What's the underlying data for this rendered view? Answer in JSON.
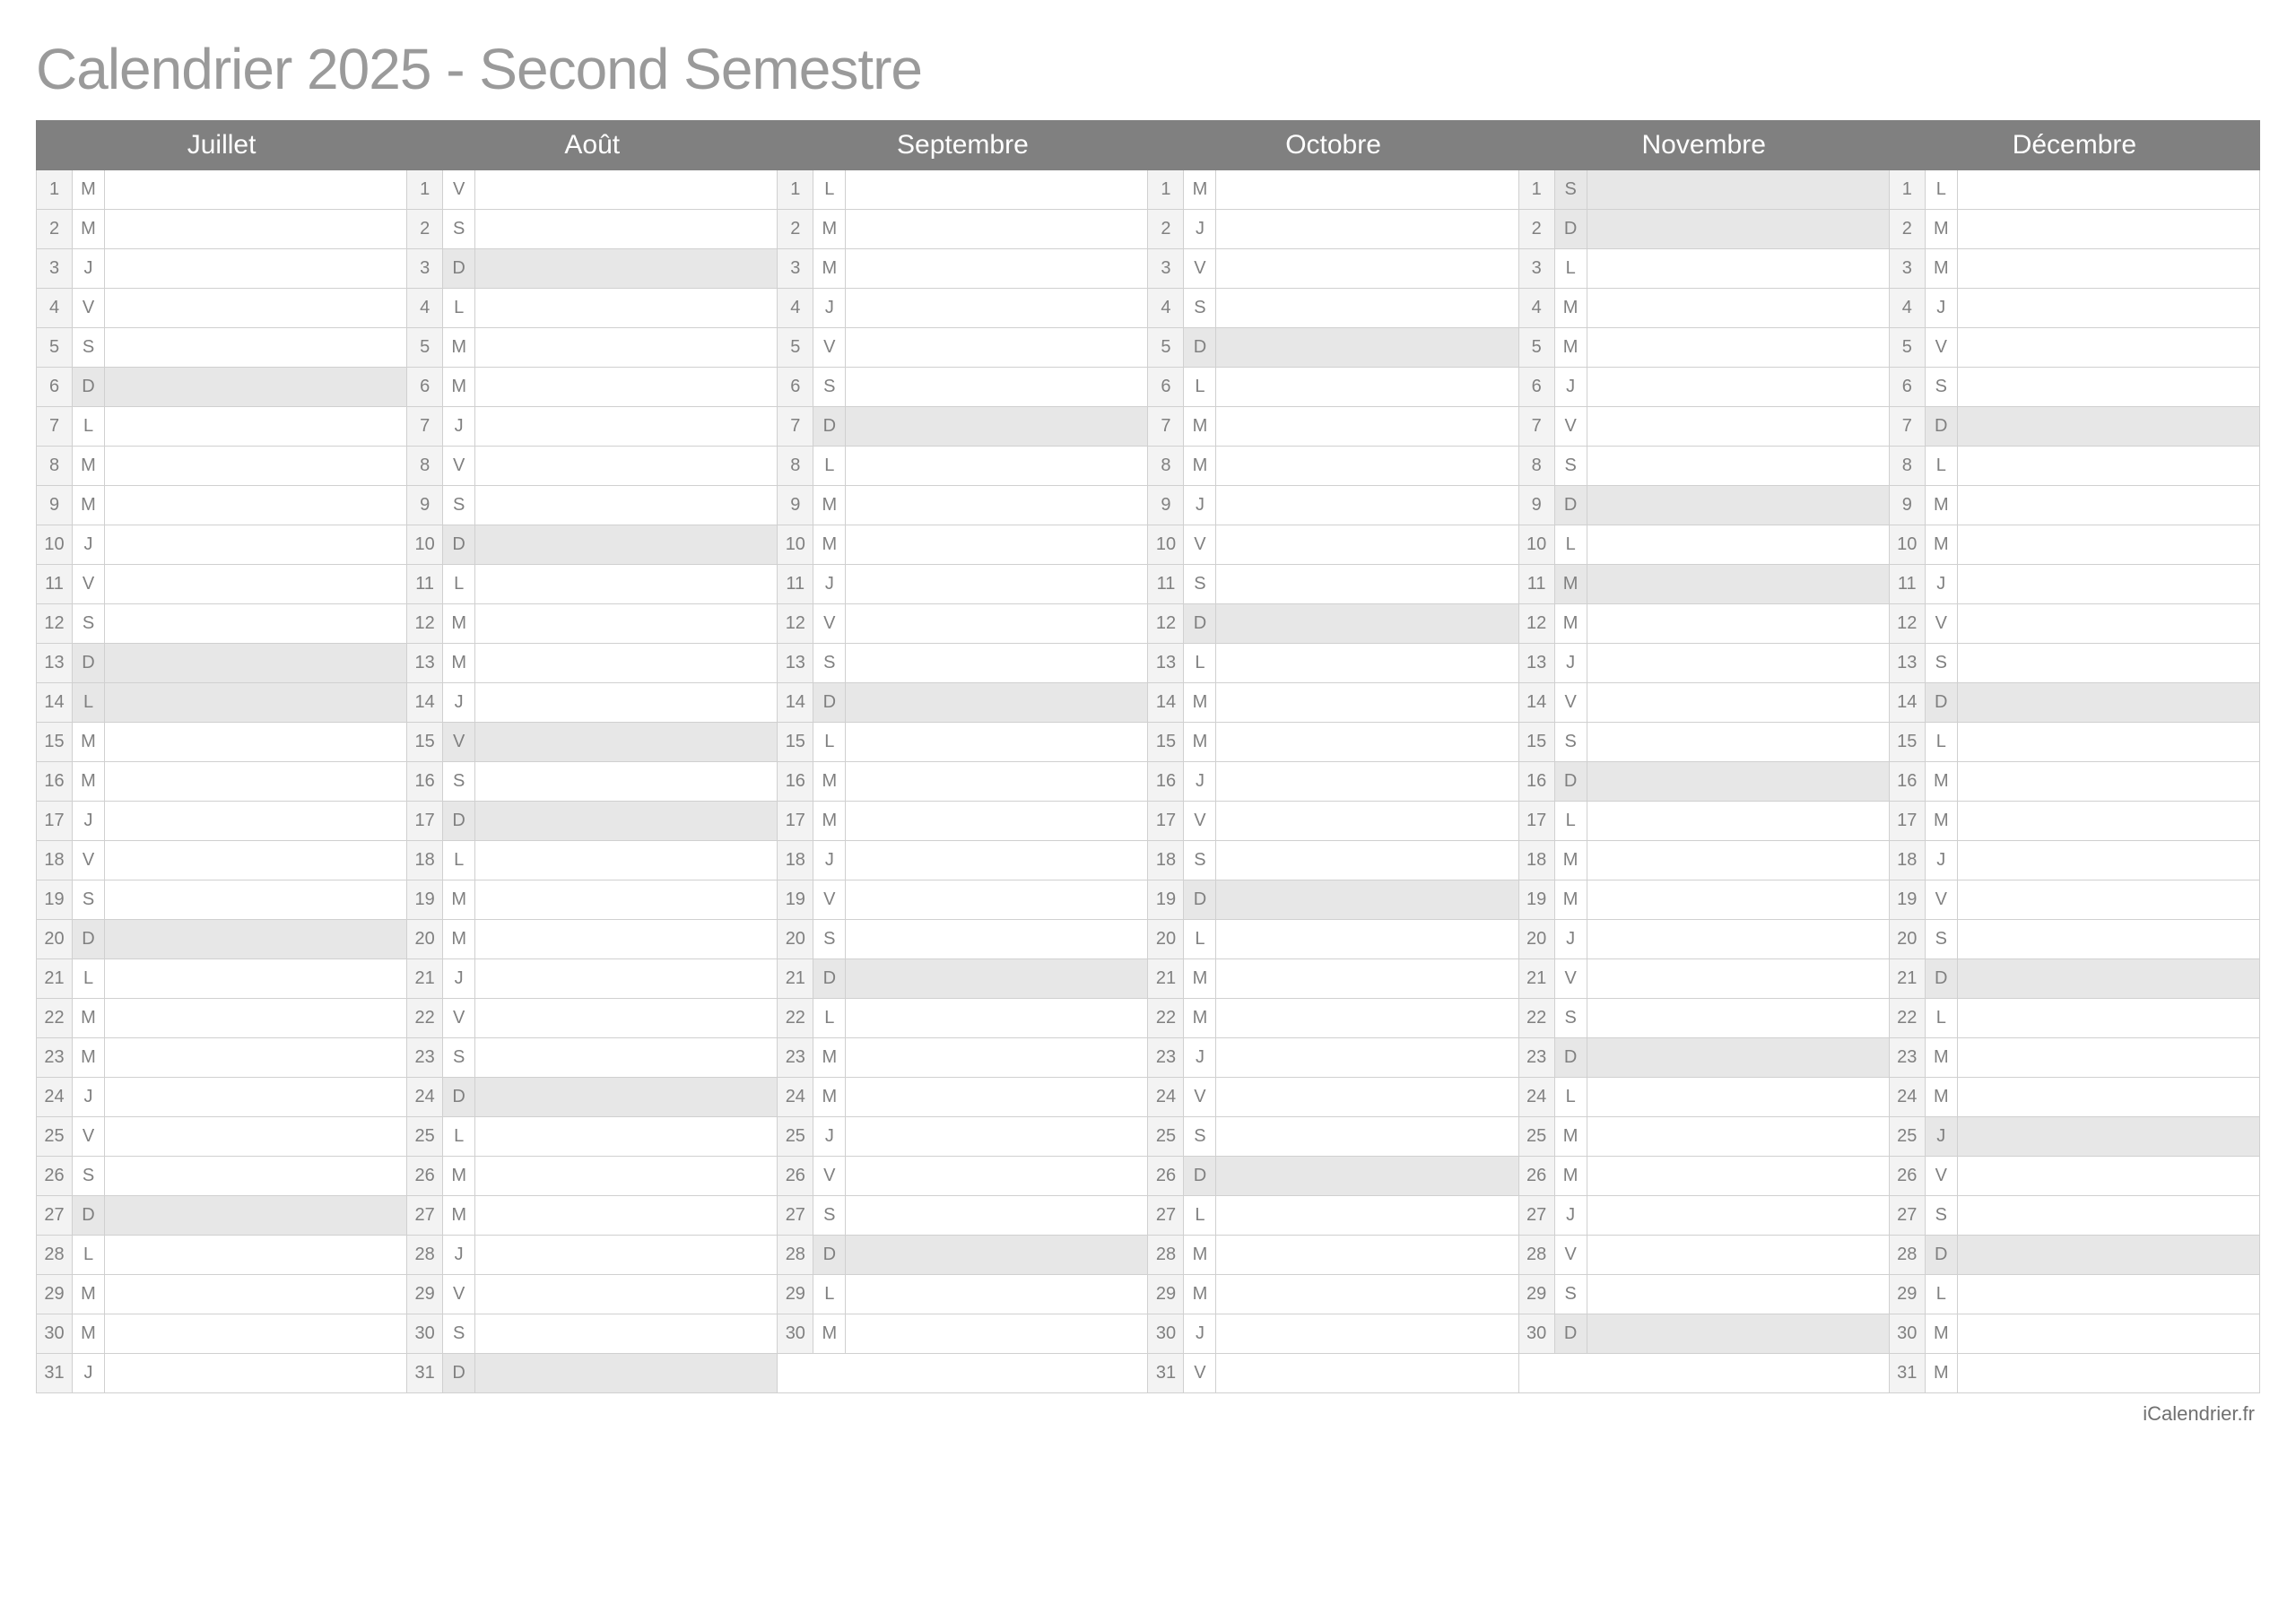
{
  "title": "Calendrier 2025 - Second Semestre",
  "footer": "iCalendrier.fr",
  "months": [
    {
      "name": "Juillet",
      "days": [
        {
          "n": 1,
          "d": "M",
          "s": false
        },
        {
          "n": 2,
          "d": "M",
          "s": false
        },
        {
          "n": 3,
          "d": "J",
          "s": false
        },
        {
          "n": 4,
          "d": "V",
          "s": false
        },
        {
          "n": 5,
          "d": "S",
          "s": false
        },
        {
          "n": 6,
          "d": "D",
          "s": true
        },
        {
          "n": 7,
          "d": "L",
          "s": false
        },
        {
          "n": 8,
          "d": "M",
          "s": false
        },
        {
          "n": 9,
          "d": "M",
          "s": false
        },
        {
          "n": 10,
          "d": "J",
          "s": false
        },
        {
          "n": 11,
          "d": "V",
          "s": false
        },
        {
          "n": 12,
          "d": "S",
          "s": false
        },
        {
          "n": 13,
          "d": "D",
          "s": true
        },
        {
          "n": 14,
          "d": "L",
          "s": true
        },
        {
          "n": 15,
          "d": "M",
          "s": false
        },
        {
          "n": 16,
          "d": "M",
          "s": false
        },
        {
          "n": 17,
          "d": "J",
          "s": false
        },
        {
          "n": 18,
          "d": "V",
          "s": false
        },
        {
          "n": 19,
          "d": "S",
          "s": false
        },
        {
          "n": 20,
          "d": "D",
          "s": true
        },
        {
          "n": 21,
          "d": "L",
          "s": false
        },
        {
          "n": 22,
          "d": "M",
          "s": false
        },
        {
          "n": 23,
          "d": "M",
          "s": false
        },
        {
          "n": 24,
          "d": "J",
          "s": false
        },
        {
          "n": 25,
          "d": "V",
          "s": false
        },
        {
          "n": 26,
          "d": "S",
          "s": false
        },
        {
          "n": 27,
          "d": "D",
          "s": true
        },
        {
          "n": 28,
          "d": "L",
          "s": false
        },
        {
          "n": 29,
          "d": "M",
          "s": false
        },
        {
          "n": 30,
          "d": "M",
          "s": false
        },
        {
          "n": 31,
          "d": "J",
          "s": false
        }
      ]
    },
    {
      "name": "Août",
      "days": [
        {
          "n": 1,
          "d": "V",
          "s": false
        },
        {
          "n": 2,
          "d": "S",
          "s": false
        },
        {
          "n": 3,
          "d": "D",
          "s": true
        },
        {
          "n": 4,
          "d": "L",
          "s": false
        },
        {
          "n": 5,
          "d": "M",
          "s": false
        },
        {
          "n": 6,
          "d": "M",
          "s": false
        },
        {
          "n": 7,
          "d": "J",
          "s": false
        },
        {
          "n": 8,
          "d": "V",
          "s": false
        },
        {
          "n": 9,
          "d": "S",
          "s": false
        },
        {
          "n": 10,
          "d": "D",
          "s": true
        },
        {
          "n": 11,
          "d": "L",
          "s": false
        },
        {
          "n": 12,
          "d": "M",
          "s": false
        },
        {
          "n": 13,
          "d": "M",
          "s": false
        },
        {
          "n": 14,
          "d": "J",
          "s": false
        },
        {
          "n": 15,
          "d": "V",
          "s": true
        },
        {
          "n": 16,
          "d": "S",
          "s": false
        },
        {
          "n": 17,
          "d": "D",
          "s": true
        },
        {
          "n": 18,
          "d": "L",
          "s": false
        },
        {
          "n": 19,
          "d": "M",
          "s": false
        },
        {
          "n": 20,
          "d": "M",
          "s": false
        },
        {
          "n": 21,
          "d": "J",
          "s": false
        },
        {
          "n": 22,
          "d": "V",
          "s": false
        },
        {
          "n": 23,
          "d": "S",
          "s": false
        },
        {
          "n": 24,
          "d": "D",
          "s": true
        },
        {
          "n": 25,
          "d": "L",
          "s": false
        },
        {
          "n": 26,
          "d": "M",
          "s": false
        },
        {
          "n": 27,
          "d": "M",
          "s": false
        },
        {
          "n": 28,
          "d": "J",
          "s": false
        },
        {
          "n": 29,
          "d": "V",
          "s": false
        },
        {
          "n": 30,
          "d": "S",
          "s": false
        },
        {
          "n": 31,
          "d": "D",
          "s": true
        }
      ]
    },
    {
      "name": "Septembre",
      "days": [
        {
          "n": 1,
          "d": "L",
          "s": false
        },
        {
          "n": 2,
          "d": "M",
          "s": false
        },
        {
          "n": 3,
          "d": "M",
          "s": false
        },
        {
          "n": 4,
          "d": "J",
          "s": false
        },
        {
          "n": 5,
          "d": "V",
          "s": false
        },
        {
          "n": 6,
          "d": "S",
          "s": false
        },
        {
          "n": 7,
          "d": "D",
          "s": true
        },
        {
          "n": 8,
          "d": "L",
          "s": false
        },
        {
          "n": 9,
          "d": "M",
          "s": false
        },
        {
          "n": 10,
          "d": "M",
          "s": false
        },
        {
          "n": 11,
          "d": "J",
          "s": false
        },
        {
          "n": 12,
          "d": "V",
          "s": false
        },
        {
          "n": 13,
          "d": "S",
          "s": false
        },
        {
          "n": 14,
          "d": "D",
          "s": true
        },
        {
          "n": 15,
          "d": "L",
          "s": false
        },
        {
          "n": 16,
          "d": "M",
          "s": false
        },
        {
          "n": 17,
          "d": "M",
          "s": false
        },
        {
          "n": 18,
          "d": "J",
          "s": false
        },
        {
          "n": 19,
          "d": "V",
          "s": false
        },
        {
          "n": 20,
          "d": "S",
          "s": false
        },
        {
          "n": 21,
          "d": "D",
          "s": true
        },
        {
          "n": 22,
          "d": "L",
          "s": false
        },
        {
          "n": 23,
          "d": "M",
          "s": false
        },
        {
          "n": 24,
          "d": "M",
          "s": false
        },
        {
          "n": 25,
          "d": "J",
          "s": false
        },
        {
          "n": 26,
          "d": "V",
          "s": false
        },
        {
          "n": 27,
          "d": "S",
          "s": false
        },
        {
          "n": 28,
          "d": "D",
          "s": true
        },
        {
          "n": 29,
          "d": "L",
          "s": false
        },
        {
          "n": 30,
          "d": "M",
          "s": false
        }
      ]
    },
    {
      "name": "Octobre",
      "days": [
        {
          "n": 1,
          "d": "M",
          "s": false
        },
        {
          "n": 2,
          "d": "J",
          "s": false
        },
        {
          "n": 3,
          "d": "V",
          "s": false
        },
        {
          "n": 4,
          "d": "S",
          "s": false
        },
        {
          "n": 5,
          "d": "D",
          "s": true
        },
        {
          "n": 6,
          "d": "L",
          "s": false
        },
        {
          "n": 7,
          "d": "M",
          "s": false
        },
        {
          "n": 8,
          "d": "M",
          "s": false
        },
        {
          "n": 9,
          "d": "J",
          "s": false
        },
        {
          "n": 10,
          "d": "V",
          "s": false
        },
        {
          "n": 11,
          "d": "S",
          "s": false
        },
        {
          "n": 12,
          "d": "D",
          "s": true
        },
        {
          "n": 13,
          "d": "L",
          "s": false
        },
        {
          "n": 14,
          "d": "M",
          "s": false
        },
        {
          "n": 15,
          "d": "M",
          "s": false
        },
        {
          "n": 16,
          "d": "J",
          "s": false
        },
        {
          "n": 17,
          "d": "V",
          "s": false
        },
        {
          "n": 18,
          "d": "S",
          "s": false
        },
        {
          "n": 19,
          "d": "D",
          "s": true
        },
        {
          "n": 20,
          "d": "L",
          "s": false
        },
        {
          "n": 21,
          "d": "M",
          "s": false
        },
        {
          "n": 22,
          "d": "M",
          "s": false
        },
        {
          "n": 23,
          "d": "J",
          "s": false
        },
        {
          "n": 24,
          "d": "V",
          "s": false
        },
        {
          "n": 25,
          "d": "S",
          "s": false
        },
        {
          "n": 26,
          "d": "D",
          "s": true
        },
        {
          "n": 27,
          "d": "L",
          "s": false
        },
        {
          "n": 28,
          "d": "M",
          "s": false
        },
        {
          "n": 29,
          "d": "M",
          "s": false
        },
        {
          "n": 30,
          "d": "J",
          "s": false
        },
        {
          "n": 31,
          "d": "V",
          "s": false
        }
      ]
    },
    {
      "name": "Novembre",
      "days": [
        {
          "n": 1,
          "d": "S",
          "s": true
        },
        {
          "n": 2,
          "d": "D",
          "s": true
        },
        {
          "n": 3,
          "d": "L",
          "s": false
        },
        {
          "n": 4,
          "d": "M",
          "s": false
        },
        {
          "n": 5,
          "d": "M",
          "s": false
        },
        {
          "n": 6,
          "d": "J",
          "s": false
        },
        {
          "n": 7,
          "d": "V",
          "s": false
        },
        {
          "n": 8,
          "d": "S",
          "s": false
        },
        {
          "n": 9,
          "d": "D",
          "s": true
        },
        {
          "n": 10,
          "d": "L",
          "s": false
        },
        {
          "n": 11,
          "d": "M",
          "s": true
        },
        {
          "n": 12,
          "d": "M",
          "s": false
        },
        {
          "n": 13,
          "d": "J",
          "s": false
        },
        {
          "n": 14,
          "d": "V",
          "s": false
        },
        {
          "n": 15,
          "d": "S",
          "s": false
        },
        {
          "n": 16,
          "d": "D",
          "s": true
        },
        {
          "n": 17,
          "d": "L",
          "s": false
        },
        {
          "n": 18,
          "d": "M",
          "s": false
        },
        {
          "n": 19,
          "d": "M",
          "s": false
        },
        {
          "n": 20,
          "d": "J",
          "s": false
        },
        {
          "n": 21,
          "d": "V",
          "s": false
        },
        {
          "n": 22,
          "d": "S",
          "s": false
        },
        {
          "n": 23,
          "d": "D",
          "s": true
        },
        {
          "n": 24,
          "d": "L",
          "s": false
        },
        {
          "n": 25,
          "d": "M",
          "s": false
        },
        {
          "n": 26,
          "d": "M",
          "s": false
        },
        {
          "n": 27,
          "d": "J",
          "s": false
        },
        {
          "n": 28,
          "d": "V",
          "s": false
        },
        {
          "n": 29,
          "d": "S",
          "s": false
        },
        {
          "n": 30,
          "d": "D",
          "s": true
        }
      ]
    },
    {
      "name": "Décembre",
      "days": [
        {
          "n": 1,
          "d": "L",
          "s": false
        },
        {
          "n": 2,
          "d": "M",
          "s": false
        },
        {
          "n": 3,
          "d": "M",
          "s": false
        },
        {
          "n": 4,
          "d": "J",
          "s": false
        },
        {
          "n": 5,
          "d": "V",
          "s": false
        },
        {
          "n": 6,
          "d": "S",
          "s": false
        },
        {
          "n": 7,
          "d": "D",
          "s": true
        },
        {
          "n": 8,
          "d": "L",
          "s": false
        },
        {
          "n": 9,
          "d": "M",
          "s": false
        },
        {
          "n": 10,
          "d": "M",
          "s": false
        },
        {
          "n": 11,
          "d": "J",
          "s": false
        },
        {
          "n": 12,
          "d": "V",
          "s": false
        },
        {
          "n": 13,
          "d": "S",
          "s": false
        },
        {
          "n": 14,
          "d": "D",
          "s": true
        },
        {
          "n": 15,
          "d": "L",
          "s": false
        },
        {
          "n": 16,
          "d": "M",
          "s": false
        },
        {
          "n": 17,
          "d": "M",
          "s": false
        },
        {
          "n": 18,
          "d": "J",
          "s": false
        },
        {
          "n": 19,
          "d": "V",
          "s": false
        },
        {
          "n": 20,
          "d": "S",
          "s": false
        },
        {
          "n": 21,
          "d": "D",
          "s": true
        },
        {
          "n": 22,
          "d": "L",
          "s": false
        },
        {
          "n": 23,
          "d": "M",
          "s": false
        },
        {
          "n": 24,
          "d": "M",
          "s": false
        },
        {
          "n": 25,
          "d": "J",
          "s": true
        },
        {
          "n": 26,
          "d": "V",
          "s": false
        },
        {
          "n": 27,
          "d": "S",
          "s": false
        },
        {
          "n": 28,
          "d": "D",
          "s": true
        },
        {
          "n": 29,
          "d": "L",
          "s": false
        },
        {
          "n": 30,
          "d": "M",
          "s": false
        },
        {
          "n": 31,
          "d": "M",
          "s": false
        }
      ]
    }
  ]
}
